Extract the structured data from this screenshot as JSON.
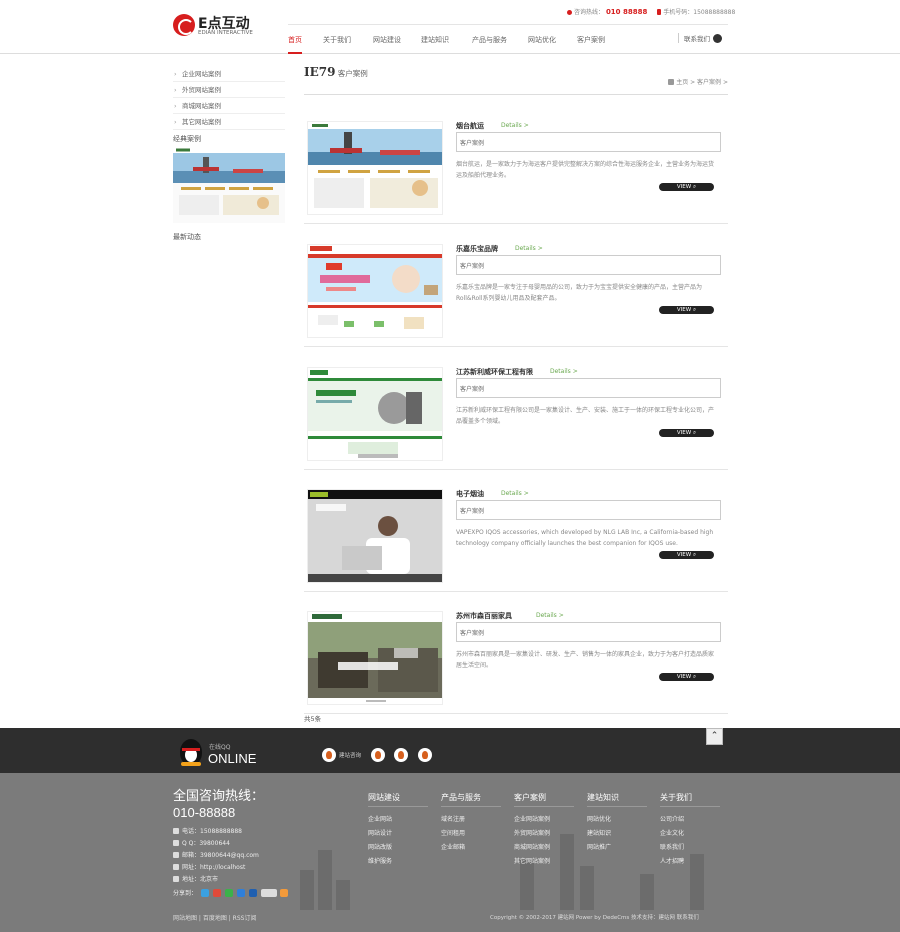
{
  "header": {
    "logo": {
      "brand": "E点互动",
      "sub": "EDIAN INTERACTIVE"
    },
    "hotline_label": "咨询热线：",
    "hotline_number": "010 88888",
    "mobile_label": "手机号码：",
    "mobile_number": "15088888888",
    "nav": [
      "首页",
      "关于我们",
      "网站建设",
      "建站知识",
      "产品与服务",
      "网站优化",
      "客户案例"
    ],
    "contact_link": "联系我们"
  },
  "sidebar": {
    "items": [
      "企业网站案例",
      "外贸网站案例",
      "商城网站案例",
      "其它网站案例"
    ],
    "section1_title": "经典案例",
    "section2_title": "最新动态"
  },
  "main": {
    "title_big": "IE79",
    "title_small": "客户案例",
    "breadcrumb": "主页 > 客户案例 >",
    "details_label": "Details >",
    "view_label": "VIEW",
    "cases": [
      {
        "name": "烟台航运",
        "tag": "客户案例",
        "desc": "烟台航运，是一家致力于为海运客户提供完整解决方案的综合性海运服务企业，主营业务为海运货运及船舶代理业务。"
      },
      {
        "name": "乐嘉乐宝品牌",
        "tag": "客户案例",
        "desc": "乐嘉乐宝品牌是一家专注于母婴用品的公司，致力于为宝宝提供安全健康的产品，主营产品为Roll&Roll系列婴幼儿用品及配套产品。"
      },
      {
        "name": "江苏新利威环保工程有限",
        "tag": "客户案例",
        "desc": "江苏新利威环保工程有限公司是一家集设计、生产、安装、施工于一体的环保工程专业化公司，产品覆盖多个领域。"
      },
      {
        "name": "电子烟油",
        "tag": "客户案例",
        "desc": "VAPEXPO IQOS accessories, which developed by NLG LAB Inc, a California-based high technology company officially launches the best companion for IQOS use."
      },
      {
        "name": "苏州市森百丽家具",
        "tag": "客户案例",
        "desc": "苏州市森百丽家具是一家集设计、研发、生产、销售为一体的家具企业，致力于为客户打造品质家居生活空间。"
      }
    ],
    "total": "共5条"
  },
  "qqbar": {
    "qq_label": "在线QQ",
    "online_label": "ONLINE",
    "contacts": [
      "建站咨询",
      "",
      "",
      ""
    ]
  },
  "footer": {
    "hotline_title": "全国咨询热线：",
    "hotline_number": "010-88888",
    "contacts": [
      {
        "icon": "phone-icon",
        "text": "电话：15088888888"
      },
      {
        "icon": "qq-icon",
        "text": "Q Q：39800644"
      },
      {
        "icon": "mail-icon",
        "text": "邮箱：39800644@qq.com"
      },
      {
        "icon": "globe-icon",
        "text": "网址：http://localhost"
      },
      {
        "icon": "location-icon",
        "text": "地址：北京市"
      }
    ],
    "share_label": "分享到：",
    "columns": [
      {
        "title": "网站建设",
        "items": [
          "企业网站",
          "网站设计",
          "网站改版",
          "维护服务"
        ]
      },
      {
        "title": "产品与服务",
        "items": [
          "域名注册",
          "空间租用",
          "企业邮箱"
        ]
      },
      {
        "title": "客户案例",
        "items": [
          "企业网站案例",
          "外贸网站案例",
          "商城网站案例",
          "其它网站案例"
        ]
      },
      {
        "title": "建站知识",
        "items": [
          "网站优化",
          "建站知识",
          "网站推广"
        ]
      },
      {
        "title": "关于我们",
        "items": [
          "公司介绍",
          "企业文化",
          "联系我们",
          "人才招聘"
        ]
      }
    ],
    "copy_left": "网站地图 | 百度地图 | RSS订阅",
    "copy_right": "Copyright © 2002-2017 建站网 Power by DedeCms 技术支持：建站网 联系我们"
  },
  "colors": {
    "accent": "#d71e1e",
    "details": "#6aa84f",
    "footer_bg": "#7b7b7b",
    "qqbar_bg": "#2e2e2e"
  }
}
